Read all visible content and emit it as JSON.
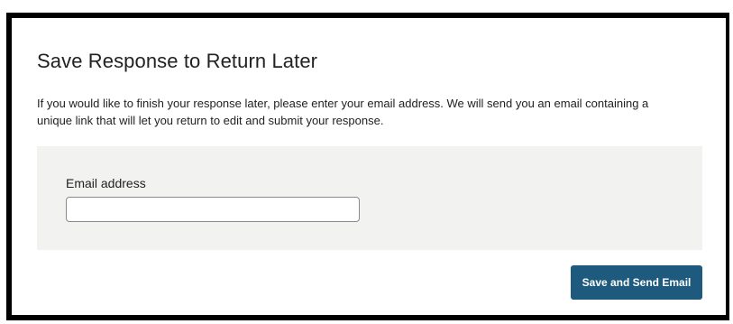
{
  "dialog": {
    "title": "Save Response to Return Later",
    "description": "If you would like to finish your response later, please enter your email address. We will send you an email containing a unique link that will let you return to edit and submit your response."
  },
  "form": {
    "email_label": "Email address",
    "email_value": ""
  },
  "actions": {
    "save_button_label": "Save and Send Email"
  },
  "colors": {
    "primary_button": "#1e5a7e",
    "panel_background": "#f2f2f0",
    "border": "#000000"
  }
}
